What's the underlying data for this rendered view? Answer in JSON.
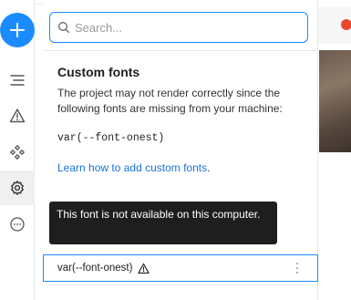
{
  "search": {
    "placeholder": "Search..."
  },
  "custom_fonts": {
    "title": "Custom fonts",
    "description": "The project may not render correctly since the following fonts are missing from your machine:",
    "missing_font": "var(--font-onest)",
    "learn_link": "Learn how to add custom fonts",
    "learn_suffix": "."
  },
  "tooltip": {
    "text": "This font is not available on this computer."
  },
  "font_row": {
    "name": "var(--font-onest)"
  },
  "colors": {
    "accent": "#1a8cff",
    "tooltip_bg": "#1e1e1e",
    "link": "#1a73d9"
  },
  "icons": [
    "plus-icon",
    "layers-icon",
    "warning-icon",
    "components-icon",
    "settings-icon",
    "more-icon",
    "search-icon",
    "kebab-menu-icon"
  ]
}
